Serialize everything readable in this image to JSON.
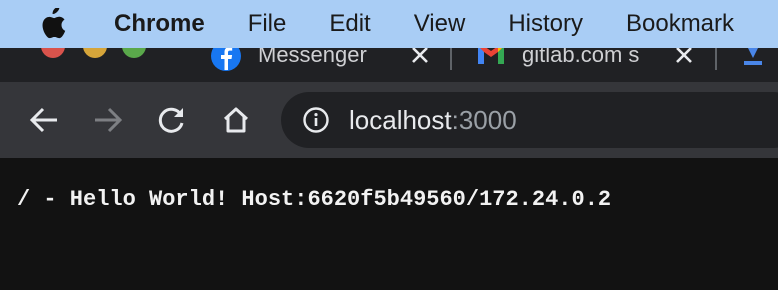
{
  "menubar": {
    "app_name": "Chrome",
    "items": [
      "File",
      "Edit",
      "View",
      "History",
      "Bookmark"
    ]
  },
  "tabs": [
    {
      "title": "Messenger",
      "icon": "facebook-icon"
    },
    {
      "title": "gitlab.com s",
      "icon": "gmail-icon"
    },
    {
      "title": "",
      "icon": "download-icon"
    }
  ],
  "omnibox": {
    "host": "localhost",
    "port": ":3000"
  },
  "page": {
    "text": "/ - Hello World! Host:6620f5b49560/172.24.0.2"
  },
  "colors": {
    "menubar": "#a9cdf5",
    "toolbar": "#35363a",
    "tabstrip": "#202124",
    "page_bg": "#121212",
    "facebook": "#1877f2",
    "gmail_red": "#ea4335"
  }
}
